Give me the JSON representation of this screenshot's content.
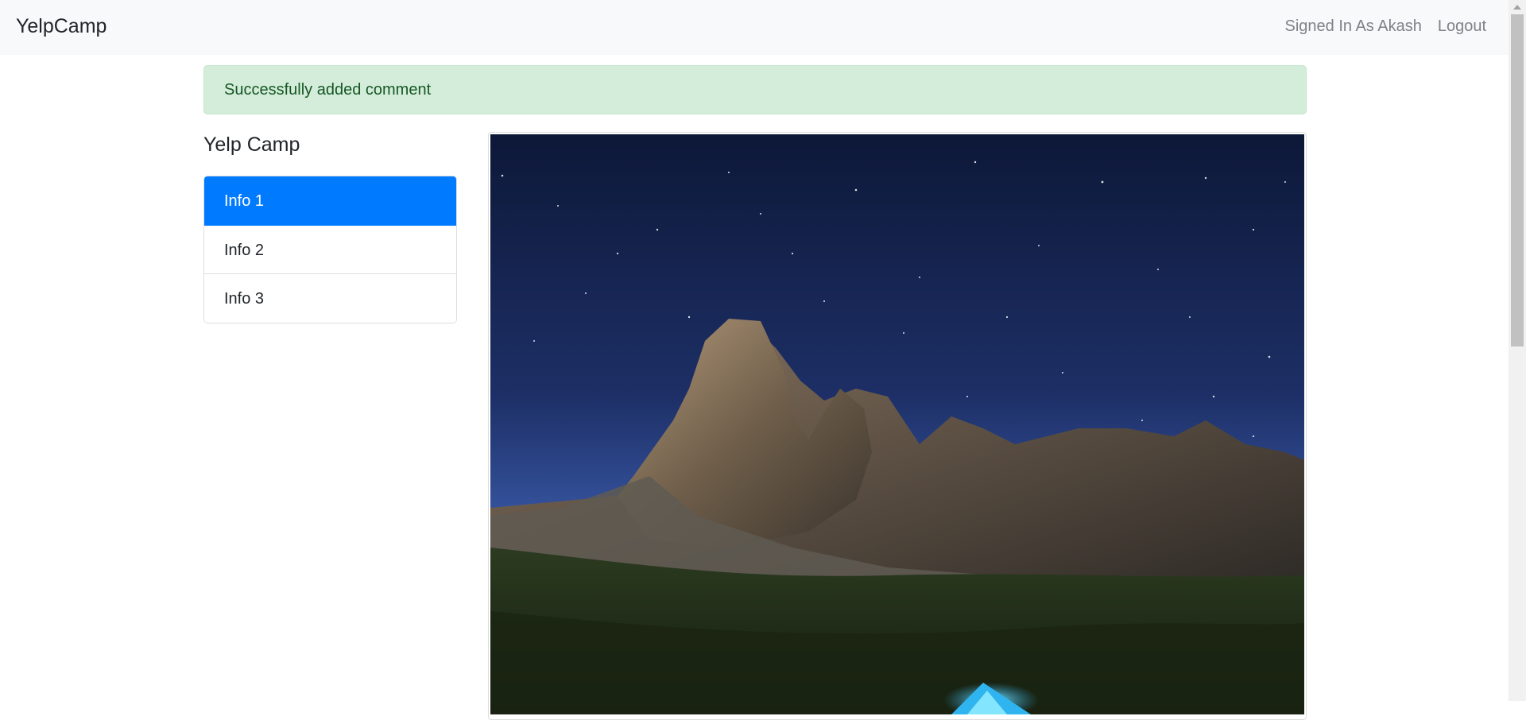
{
  "navbar": {
    "brand": "YelpCamp",
    "signed_in": "Signed In As Akash",
    "logout": "Logout"
  },
  "alert": {
    "message": "Successfully added comment"
  },
  "sidebar": {
    "title": "Yelp Camp",
    "items": [
      {
        "label": "Info 1",
        "active": true
      },
      {
        "label": "Info 2",
        "active": false
      },
      {
        "label": "Info 3",
        "active": false
      }
    ]
  },
  "image": {
    "subject": "mountain-night-camp-photo"
  },
  "colors": {
    "primary": "#007bff",
    "alert_bg": "#d4edda",
    "alert_text": "#155724",
    "navbar_bg": "#f8f9fa"
  }
}
